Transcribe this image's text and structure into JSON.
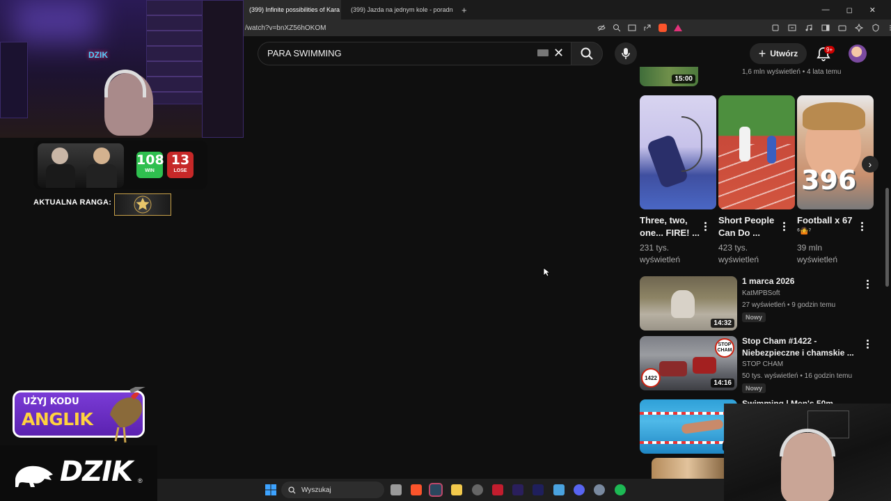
{
  "browser": {
    "tabs": [
      {
        "title": "(399) Infinite possibilities of Kara",
        "close": "✕"
      },
      {
        "title": "(399) Jazda na jednym kole - poradn"
      }
    ],
    "new_tab": "+",
    "window_controls": [
      "—",
      "◻",
      "✕"
    ],
    "url": "/watch?v=bnXZ56hOKOM"
  },
  "youtube": {
    "search_value": "PARA SWIMMING",
    "create_label": "Utwórz",
    "notifications_badge": "9+"
  },
  "top_video": {
    "duration": "15:00",
    "meta": "1,6 mln wyświetleń • 4 lata temu"
  },
  "shorts": [
    {
      "title_line1": "Three, two,",
      "title_line2": "one... FIRE! ...",
      "views_line1": "231 tys.",
      "views_line2": "wyświetleń"
    },
    {
      "title_line1": "Short People",
      "title_line2": "Can Do ...",
      "views_line1": "423 tys.",
      "views_line2": "wyświetleń"
    },
    {
      "title_line1": "Football x 67",
      "title_line2": "⁶🤷⁷",
      "views_line1": "39 mln",
      "views_line2": "wyświetleń",
      "thumb_text": "396"
    }
  ],
  "videos": [
    {
      "title_line1": "1 marca 2026",
      "title_line2": "",
      "channel": "KatMPBSoft",
      "meta": "27 wyświetleń • 9 godzin temu",
      "badge": "Nowy",
      "duration": "14:32"
    },
    {
      "title_line1": "Stop Cham #1422 -",
      "title_line2": "Niebezpieczne i chamskie ...",
      "channel": "STOP CHAM",
      "meta": "50 tys. wyświetleń • 16 godzin temu",
      "badge": "Nowy",
      "duration": "14:16",
      "thumb_badge": "1422",
      "thumb_logo": "STOP CHAM"
    },
    {
      "title_line1": "Swimming | Men's 50m",
      "duration": "6:"
    }
  ],
  "overlay": {
    "win_count": "108",
    "win_label": "WIN",
    "lose_count": "13",
    "lose_label": "LOSE",
    "rank_label": "AKTUALNA RANGA:",
    "code_line1": "UŻYJ KODU",
    "code_line2": "ANGLIK",
    "brand": "DZIK",
    "brand_registered": "®",
    "webcam_sign": "DZIK"
  },
  "taskbar": {
    "search_placeholder": "Wyszukaj"
  },
  "colors": {
    "yt_bg": "#0f0f0f",
    "win": "#2fbf4f",
    "lose": "#c62828",
    "code_bg": "#6a2fc4",
    "code_text": "#ffd23f"
  }
}
